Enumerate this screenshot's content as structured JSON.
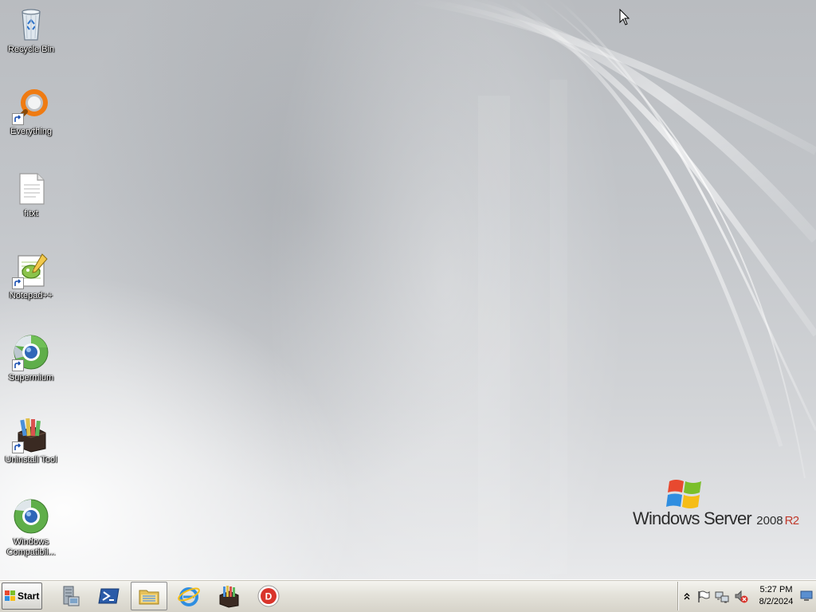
{
  "desktop": {
    "icons": [
      {
        "label": "Recycle Bin",
        "icon": "recycle-bin-icon",
        "shortcut": false
      },
      {
        "label": "Everything",
        "icon": "everything-search-icon",
        "shortcut": true
      },
      {
        "label": "f.txt",
        "icon": "text-file-icon",
        "shortcut": false
      },
      {
        "label": "Notepad++",
        "icon": "notepad-plus-plus-icon",
        "shortcut": true
      },
      {
        "label": "Supermium",
        "icon": "supermium-browser-icon",
        "shortcut": true
      },
      {
        "label": "Uninstall Tool",
        "icon": "uninstall-tool-icon",
        "shortcut": true
      },
      {
        "label_line1": "Windows",
        "label_line2": "Compatibil...",
        "icon": "windows-compatibility-icon",
        "shortcut": true
      }
    ],
    "branding": {
      "product": "Windows Server",
      "version": "2008",
      "edition": "R2"
    }
  },
  "taskbar": {
    "start_label": "Start",
    "pinned": [
      {
        "name": "server-manager-icon",
        "active": false
      },
      {
        "name": "powershell-icon",
        "active": false
      },
      {
        "name": "windows-explorer-icon",
        "active": true
      },
      {
        "name": "internet-explorer-icon",
        "active": false
      },
      {
        "name": "uninstall-tool-icon",
        "active": false
      },
      {
        "name": "red-d-app-icon",
        "active": false
      }
    ],
    "tray": {
      "icons": [
        "show-hidden-icons-chevron",
        "action-center-flag-icon",
        "network-icon",
        "volume-muted-icon"
      ],
      "time": "5:27 PM",
      "date": "8/2/2024"
    }
  },
  "colors": {
    "taskbar_bg": "#e4e2da",
    "brand_r2": "#c0392b",
    "desktop_bg": "#c2c5c9"
  }
}
